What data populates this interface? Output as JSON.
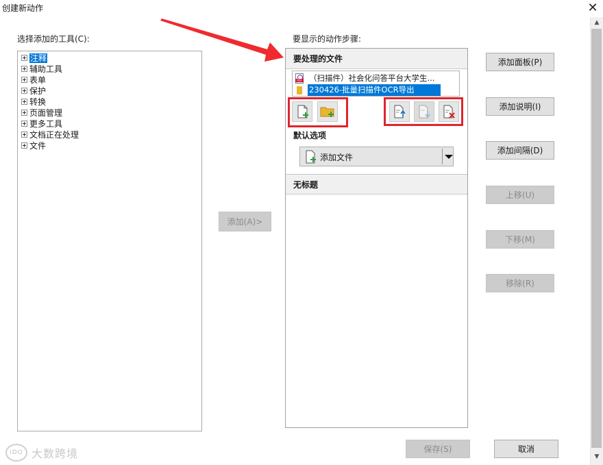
{
  "window": {
    "title": "创建新动作"
  },
  "left": {
    "label": "选择添加的工具(C):",
    "tree": [
      {
        "label": "注释",
        "selected": true
      },
      {
        "label": "辅助工具"
      },
      {
        "label": "表单"
      },
      {
        "label": "保护"
      },
      {
        "label": "转换"
      },
      {
        "label": "页面管理"
      },
      {
        "label": "更多工具"
      },
      {
        "label": "文档正在处理"
      },
      {
        "label": "文件"
      }
    ]
  },
  "add_button": {
    "label": "添加(A)>"
  },
  "right": {
    "label": "要显示的动作步骤:",
    "section_files": "要处理的文件",
    "files": [
      {
        "name": "（扫描件）社会化问答平台大学生...",
        "icon": "pdf-icon"
      },
      {
        "name": "230426-批量扫描件OCR导出",
        "icon": "folder-icon",
        "selected": true
      }
    ],
    "default_options_label": "默认选项",
    "combo_value": "添加文件",
    "section_untitled": "无标题"
  },
  "side_buttons": [
    {
      "label": "添加面板(P)",
      "enabled": true
    },
    {
      "label": "添加说明(I)",
      "enabled": true
    },
    {
      "label": "添加间隔(D)",
      "enabled": true
    },
    {
      "label": "上移(U)",
      "enabled": false
    },
    {
      "label": "下移(M)",
      "enabled": false
    },
    {
      "label": "移除(R)",
      "enabled": false
    }
  ],
  "footer": {
    "save": "保存(S)",
    "cancel": "取消"
  },
  "watermark": {
    "text": "大数跨境",
    "logo": "iDO"
  },
  "colors": {
    "accent": "#0078d7",
    "highlight": "#e0242b"
  }
}
